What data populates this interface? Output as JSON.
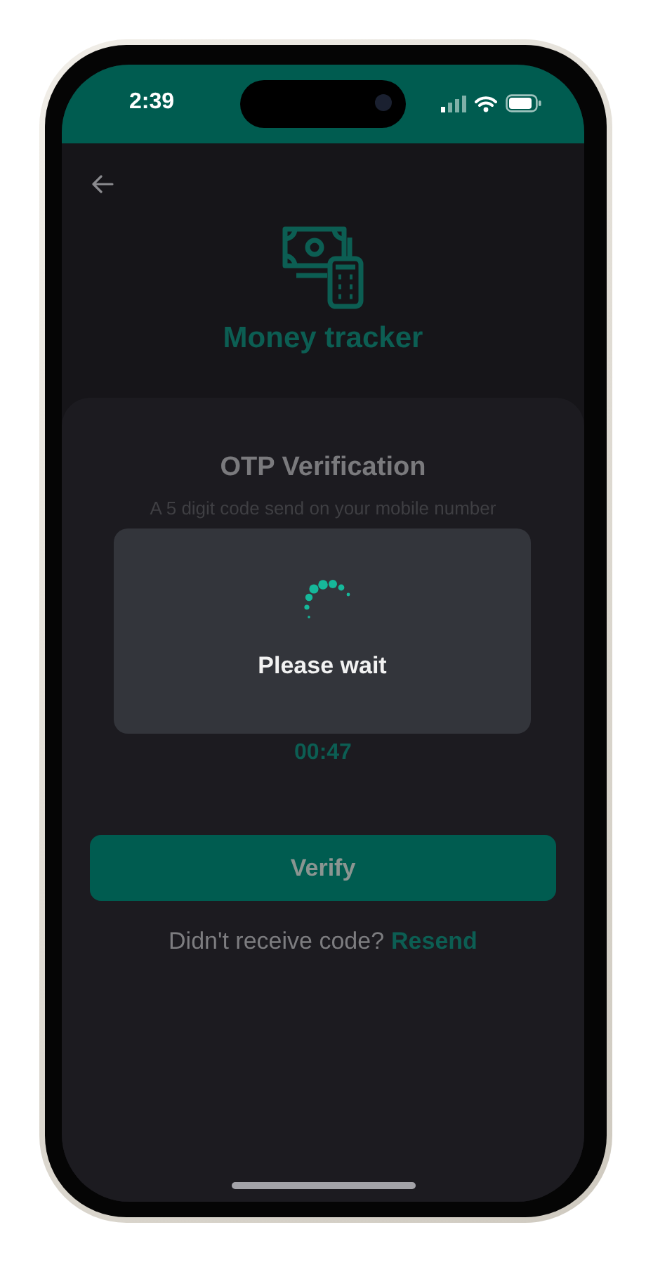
{
  "status_bar": {
    "time": "2:39"
  },
  "app": {
    "title": "Money tracker"
  },
  "otp": {
    "title": "OTP Verification",
    "subtitle": "A 5 digit code send on your mobile number",
    "timer": "00:47",
    "verify_button": "Verify",
    "resend_prompt": "Didn't receive code?",
    "resend_link": "Resend"
  },
  "dialog": {
    "message": "Please wait"
  }
}
